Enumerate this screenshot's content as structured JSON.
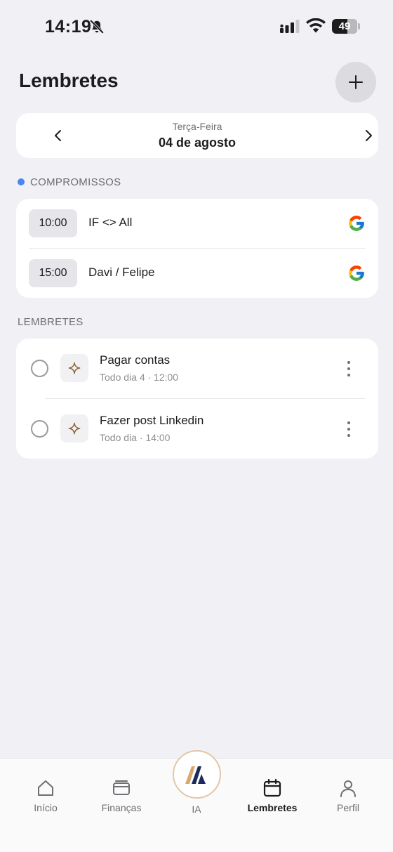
{
  "status_bar": {
    "time": "14:19",
    "battery": "49",
    "icons": [
      "bell-slash-icon",
      "cellular-signal-icon",
      "wifi-icon",
      "battery-icon"
    ]
  },
  "header": {
    "title": "Lembretes",
    "add_icon": "plus-icon"
  },
  "date_nav": {
    "weekday": "Terça-Feira",
    "date": "04 de agosto",
    "prev_icon": "chevron-left-icon",
    "next_icon": "chevron-right-icon"
  },
  "appointments": {
    "section_label": "COMPROMISSOS",
    "dot_color": "#4a86f5",
    "items": [
      {
        "time": "10:00",
        "title": "IF <> All",
        "source_icon": "google-icon"
      },
      {
        "time": "15:00",
        "title": "Davi / Felipe",
        "source_icon": "google-icon"
      }
    ]
  },
  "reminders": {
    "section_label": "LEMBRETES",
    "items": [
      {
        "title": "Pagar contas",
        "subtitle": "Todo dia 4 · 12:00",
        "icon": "sparkle-icon"
      },
      {
        "title": "Fazer post Linkedin",
        "subtitle": "Todo dia · 14:00",
        "icon": "sparkle-icon"
      }
    ]
  },
  "tab_bar": {
    "items": [
      {
        "label": "Início",
        "icon": "home-icon"
      },
      {
        "label": "Finanças",
        "icon": "wallet-icon"
      },
      {
        "label": "IA",
        "icon": "ia-logo-icon"
      },
      {
        "label": "Lembretes",
        "icon": "calendar-icon",
        "active": true
      },
      {
        "label": "Perfil",
        "icon": "person-icon"
      }
    ]
  },
  "colors": {
    "background": "#f0f0f5",
    "card": "#ffffff",
    "accent_blue": "#4a86f5",
    "sparkle_brown": "#8b6336",
    "ia_ring": "#e3c6a6"
  }
}
